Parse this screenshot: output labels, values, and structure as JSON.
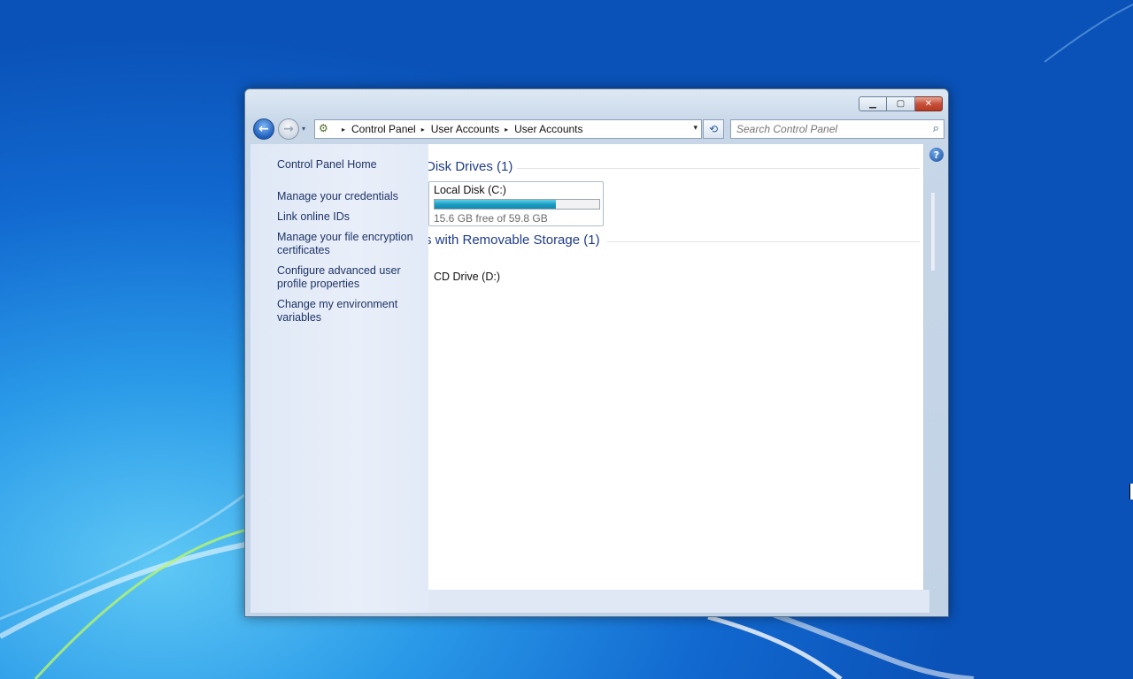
{
  "window": {
    "caption_buttons": {
      "minimize_glyph": "▁",
      "maximize_glyph": "▢",
      "close_glyph": "✕"
    },
    "nav": {
      "back_glyph": "←",
      "forward_glyph": "→",
      "recent_glyph": "▾"
    },
    "address": {
      "icon_glyph": "⚙",
      "separator_glyph": "▸",
      "breadcrumbs": [
        "Control Panel",
        "User Accounts",
        "User Accounts"
      ],
      "dropdown_glyph": "▾",
      "refresh_glyph": "⟲"
    },
    "search": {
      "placeholder": "Search Control Panel",
      "icon_glyph": "⌕"
    },
    "help_glyph": "?"
  },
  "left_pane": {
    "home": "Control Panel Home",
    "links": [
      "Manage your credentials",
      "Link online IDs",
      "Manage your file encryption certificates",
      "Configure advanced user profile properties",
      "Change my environment variables"
    ]
  },
  "content": {
    "group_hdd": "Disk Drives (1)",
    "local_disk": {
      "name": "Local Disk (C:)",
      "free": "15.6 GB free of 59.8 GB",
      "used_fraction": 0.739
    },
    "group_removable": "s with Removable Storage (1)",
    "cd_drive": "CD Drive (D:)"
  },
  "colors": {
    "link": "#1e3366",
    "group_heading": "#1e3c8a",
    "close_button": "#c7503a",
    "usage_bar": "#1d9ec4"
  }
}
